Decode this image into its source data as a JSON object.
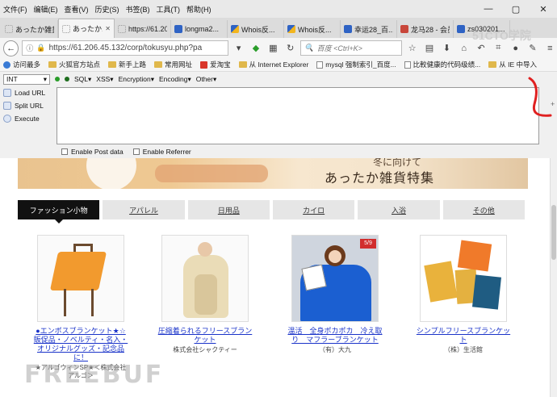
{
  "menubar": {
    "items": [
      "文件(F)",
      "编辑(E)",
      "查看(V)",
      "历史(S)",
      "书签(B)",
      "工具(T)",
      "帮助(H)"
    ]
  },
  "window_controls": {
    "minimize": "—",
    "maximize": "▢",
    "close": "✕"
  },
  "tabs": [
    {
      "label": "あったか雑貨...",
      "active": false,
      "fav": "none"
    },
    {
      "label": "あったか...",
      "active": true,
      "fav": "none"
    },
    {
      "label": "https://61.20...",
      "active": false,
      "fav": "none"
    },
    {
      "label": "longma2...",
      "active": false,
      "fav": "blue"
    },
    {
      "label": "Whois反...",
      "active": false,
      "fav": "yellowblue"
    },
    {
      "label": "Whois反...",
      "active": false,
      "fav": "yellowblue"
    },
    {
      "label": "幸运28_百...",
      "active": false,
      "fav": "blue"
    },
    {
      "label": "龙马28 - 会员...",
      "active": false,
      "fav": "red"
    },
    {
      "label": "zs030201...",
      "active": false,
      "fav": "blue"
    }
  ],
  "navbar": {
    "url": "https://61.206.45.132/corp/tokusyu.php?pa",
    "search_placeholder": "百度 <Ctrl+K>"
  },
  "bookmarks": [
    {
      "label": "访问最多",
      "icon": "gear"
    },
    {
      "label": "火狐官方站点",
      "icon": "fold"
    },
    {
      "label": "新手上路",
      "icon": "fold"
    },
    {
      "label": "常用网址",
      "icon": "fold"
    },
    {
      "label": "爱淘宝",
      "icon": "red"
    },
    {
      "label": "从 Internet Explorer",
      "icon": "fold"
    },
    {
      "label": "mysql 强制索引_百度...",
      "icon": "doc"
    },
    {
      "label": "比較健康的代码级绩...",
      "icon": "doc"
    },
    {
      "label": "从 IE 中导入",
      "icon": "fold"
    }
  ],
  "hackbar": {
    "type_select": "INT",
    "menu": [
      "SQL▾",
      "XSS▾",
      "Encryption▾",
      "Encoding▾",
      "Other▾"
    ],
    "actions": [
      "Load URL",
      "Split URL",
      "Execute"
    ],
    "enable_post": "Enable Post data",
    "enable_referrer": "Enable Referrer",
    "textarea_value": ""
  },
  "banner": {
    "subtitle": "冬に向けて",
    "title": "あったか雑貨特集"
  },
  "categories": [
    {
      "label": "ファッション小物",
      "active": true
    },
    {
      "label": "アパレル",
      "active": false
    },
    {
      "label": "日用品",
      "active": false
    },
    {
      "label": "カイロ",
      "active": false
    },
    {
      "label": "入浴",
      "active": false
    },
    {
      "label": "その他",
      "active": false
    }
  ],
  "products": [
    {
      "name": "●エンボスブランケット★☆販促品・ノベルティ・名入・オリジナルグッズ・記念品に！",
      "maker": "★アルゴウィンSP★＜株式会社アルゴ＞"
    },
    {
      "name": "圧縮着られるフリースブランケット",
      "maker": "株式会社シャクティー"
    },
    {
      "name": "温活　全身ポカポカ　冷え取り　マフラーブランケット",
      "maker": "（有）大九"
    },
    {
      "name": "シンプルフリースブランケット",
      "maker": "（株）生活館"
    }
  ],
  "product_tag": "5/9",
  "watermark": "FREEBUF",
  "watermark2": "51CTO学院",
  "colors": {
    "link": "#1a33c9",
    "active_tab": "#111111",
    "annotation": "#e02020"
  }
}
